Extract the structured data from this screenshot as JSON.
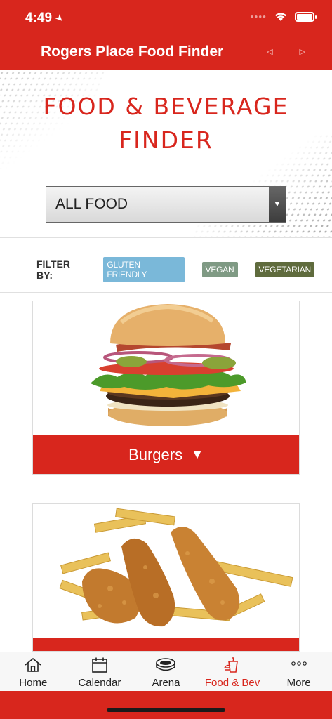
{
  "status": {
    "time": "4:49"
  },
  "nav": {
    "title": "Rogers Place Food Finder"
  },
  "hero": {
    "title_line1": "FOOD & BEVERAGE",
    "title_line2": "FINDER"
  },
  "select": {
    "value": "ALL FOOD"
  },
  "filter": {
    "label": "FILTER BY:",
    "chips": [
      "GLUTEN FRIENDLY",
      "VEGAN",
      "VEGETARIAN"
    ]
  },
  "cards": [
    {
      "label": "Burgers",
      "image": "burger"
    },
    {
      "label": "",
      "image": "chicken-fingers-and-fries"
    }
  ],
  "tabs": [
    {
      "label": "Home",
      "icon": "home-icon"
    },
    {
      "label": "Calendar",
      "icon": "calendar-icon"
    },
    {
      "label": "Arena",
      "icon": "arena-icon"
    },
    {
      "label": "Food & Bev",
      "icon": "food-bev-icon"
    },
    {
      "label": "More",
      "icon": "more-icon"
    }
  ],
  "colors": {
    "brand_red": "#d8261d",
    "gluten_friendly": "#7ab8d9",
    "vegan": "#7f9a84",
    "vegetarian": "#5f6b3d"
  }
}
